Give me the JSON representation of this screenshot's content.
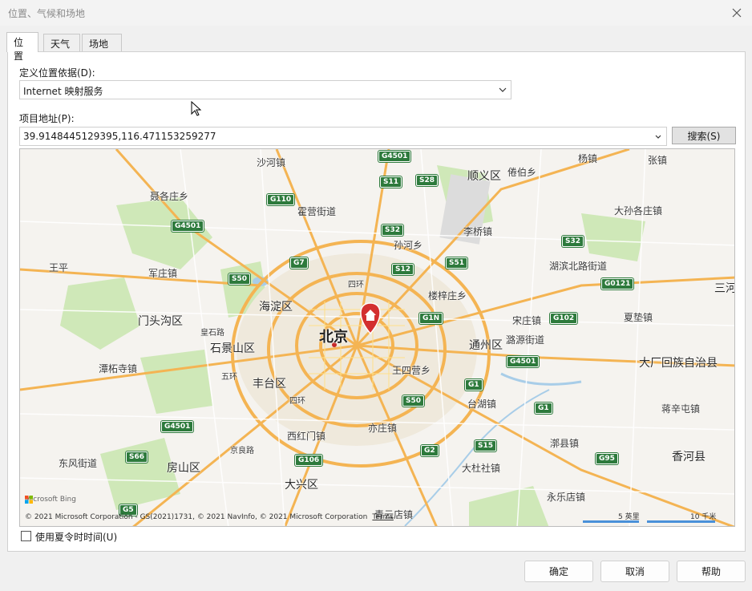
{
  "window": {
    "title": "位置、气候和场地"
  },
  "tabs": [
    {
      "label": "位置"
    },
    {
      "label": "天气"
    },
    {
      "label": "场地"
    }
  ],
  "location": {
    "define_label": "定义位置依据(D):",
    "define_value": "Internet 映射服务",
    "address_label": "项目地址(P):",
    "address_value": "39.9148445129395,116.471153259277",
    "search_button": "搜索(S)"
  },
  "map": {
    "attribution": "© 2021 Microsoft Corporation - GS(2021)1731, © 2021 NavInfo, © 2021 Microsoft Corporation",
    "terms": "Terms",
    "brand": "Microsoft Bing",
    "scale_1": "5 英里",
    "scale_2": "10 千米",
    "labels": [
      "沙河镇",
      "顺义区",
      "倦伯乡",
      "杨镇",
      "张镇",
      "聂各庄乡",
      "霍营街道",
      "李桥镇",
      "大孙各庄镇",
      "孙河乡",
      "湖滨北路街道",
      "王平",
      "军庄镇",
      "海淀区",
      "四环",
      "楼梓庄乡",
      "三河",
      "门头沟区",
      "宋庄镇",
      "夏垫镇",
      "皇石路",
      "北京",
      "石景山区",
      "潞源街道",
      "通州区",
      "大厂回族自治县",
      "潭柘寺镇",
      "王四营乡",
      "丰台区",
      "台湖镇",
      "蒋辛屯镇",
      "西红门镇",
      "亦庄镇",
      "东风街道",
      "房山区",
      "漷县镇",
      "香河县",
      "大兴区",
      "大杜社镇",
      "永乐店镇",
      "青云店镇",
      "五环",
      "京良路"
    ],
    "shields": [
      "G4501",
      "S11",
      "S28",
      "G110",
      "G4501",
      "S32",
      "G7",
      "S50",
      "S12",
      "S51",
      "S32",
      "G0121",
      "G1N",
      "G102",
      "G4501",
      "G1",
      "S50",
      "G1",
      "G4501",
      "S66",
      "G106",
      "S15",
      "G2",
      "G95",
      "G5"
    ]
  },
  "dst": {
    "label": "使用夏令时时间(U)",
    "checked": false
  },
  "buttons": {
    "ok": "确定",
    "cancel": "取消",
    "help": "帮助"
  }
}
